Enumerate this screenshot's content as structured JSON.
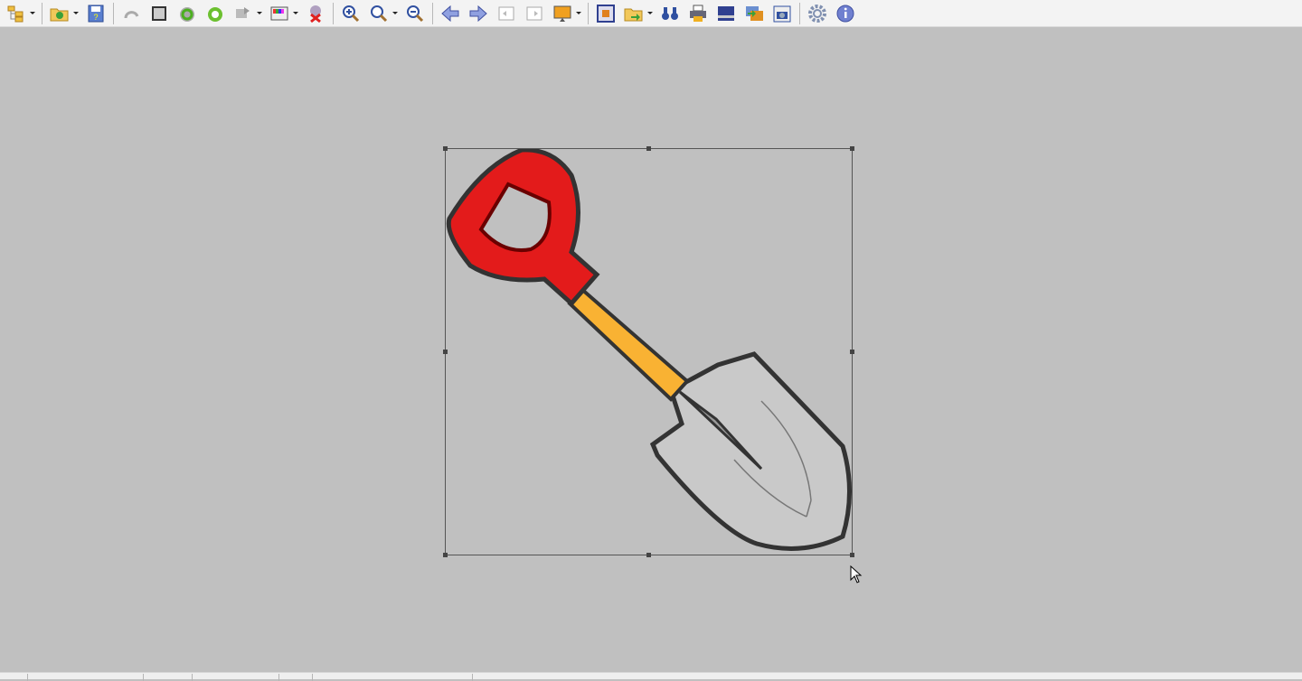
{
  "toolbar": {
    "buttons": [
      "thumbnails",
      "open",
      "save-as",
      "undo",
      "crop",
      "rotate-left",
      "rotate-right",
      "batch",
      "color-corrections",
      "delete",
      "zoom-in",
      "zoom-original",
      "zoom-out",
      "previous",
      "next",
      "first",
      "last",
      "slideshow",
      "fit-window",
      "copy-to-folder",
      "find",
      "print",
      "scan",
      "convert",
      "capture",
      "settings",
      "info"
    ]
  },
  "colors": {
    "canvas_bg": "#c0c0c0",
    "handle": "#e31b1b",
    "shaft": "#f9b233",
    "blade": "#c8c8c8"
  },
  "status_bar": {
    "segments": []
  }
}
